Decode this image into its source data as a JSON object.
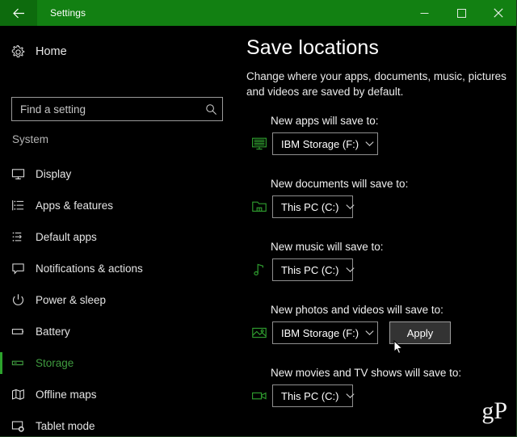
{
  "window": {
    "title": "Settings",
    "back_icon": "back-arrow-icon",
    "minimize_label": "–",
    "maximize_label": "□",
    "close_label": "✕",
    "titlebar_color": "#128012",
    "accent_color": "#2ca22c"
  },
  "sidebar": {
    "home": {
      "label": "Home",
      "icon": "gear-icon"
    },
    "search": {
      "placeholder": "Find a setting",
      "value": "",
      "icon": "search-icon"
    },
    "group_label": "System",
    "items": [
      {
        "label": "Display",
        "icon": "monitor-icon",
        "selected": false
      },
      {
        "label": "Apps & features",
        "icon": "list-icon",
        "selected": false
      },
      {
        "label": "Default apps",
        "icon": "default-apps-icon",
        "selected": false
      },
      {
        "label": "Notifications & actions",
        "icon": "speech-bubble-icon",
        "selected": false
      },
      {
        "label": "Power & sleep",
        "icon": "power-icon",
        "selected": false
      },
      {
        "label": "Battery",
        "icon": "battery-icon",
        "selected": false
      },
      {
        "label": "Storage",
        "icon": "storage-icon",
        "selected": true
      },
      {
        "label": "Offline maps",
        "icon": "map-icon",
        "selected": false
      },
      {
        "label": "Tablet mode",
        "icon": "tablet-icon",
        "selected": false
      }
    ]
  },
  "main": {
    "title": "Save locations",
    "description": "Change where your apps, documents, music, pictures and videos are saved by default.",
    "sections": [
      {
        "label": "New apps will save to:",
        "icon": "apps-monitor-icon",
        "value": "IBM Storage (F:)",
        "width": "wide",
        "has_apply": false
      },
      {
        "label": "New documents will save to:",
        "icon": "documents-folder-icon",
        "value": "This PC (C:)",
        "width": "narrow",
        "has_apply": false
      },
      {
        "label": "New music will save to:",
        "icon": "music-note-icon",
        "value": "This PC (C:)",
        "width": "narrow",
        "has_apply": false
      },
      {
        "label": "New photos and videos will save to:",
        "icon": "picture-icon",
        "value": "IBM Storage (F:)",
        "width": "wide",
        "has_apply": true,
        "apply_label": "Apply"
      },
      {
        "label": "New movies and TV shows will save to:",
        "icon": "video-camera-icon",
        "value": "This PC (C:)",
        "width": "narrow",
        "has_apply": false
      }
    ],
    "watermark": "gP"
  }
}
